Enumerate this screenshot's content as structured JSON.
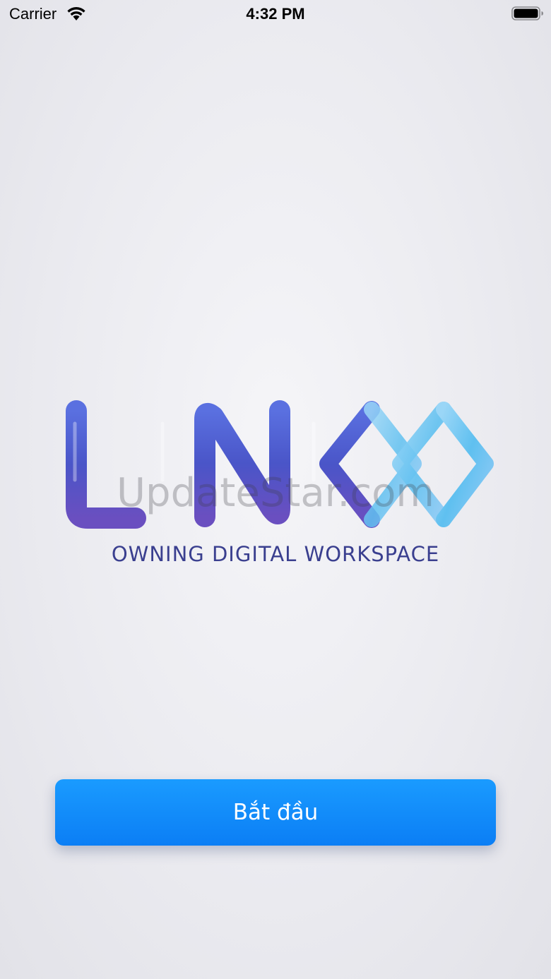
{
  "status_bar": {
    "carrier": "Carrier",
    "time": "4:32 PM",
    "icons": [
      "wifi-icon",
      "battery-icon"
    ]
  },
  "splash": {
    "logo_text": "LINKO",
    "tagline": "OWNING DIGITAL WORKSPACE",
    "watermark": "UpdateStar.com"
  },
  "actions": {
    "start_label": "Bắt đầu"
  },
  "colors": {
    "logo_dark": "#4a4fc4",
    "logo_light": "#62c3f0",
    "tagline": "#3a3f8f",
    "button": "#0b84f7"
  }
}
